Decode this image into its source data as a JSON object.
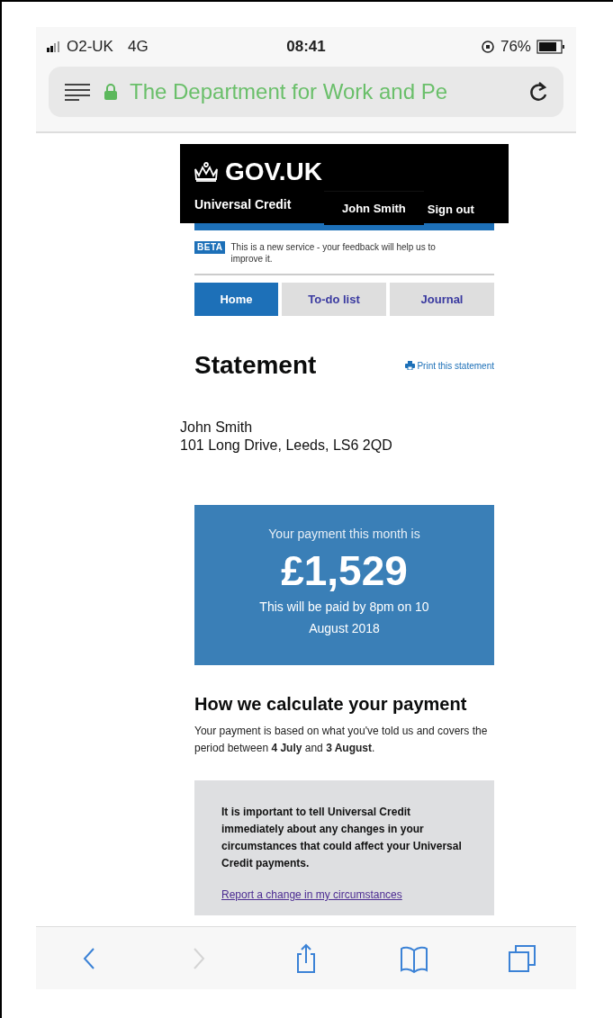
{
  "status_bar": {
    "carrier": "O2-UK",
    "network": "4G",
    "time": "08:41",
    "battery": "76%"
  },
  "address_bar": {
    "title": "The Department for Work and Pe"
  },
  "header": {
    "logo": "GOV.UK",
    "service": "Universal Credit",
    "user": "John Smith",
    "sign_out": "Sign out"
  },
  "beta": {
    "tag": "BETA",
    "message": "This is a new service - your feedback will help us to improve it."
  },
  "tabs": [
    {
      "label": "Home",
      "selected": true
    },
    {
      "label": "To-do list",
      "selected": false
    },
    {
      "label": "Journal",
      "selected": false
    }
  ],
  "title": "Statement",
  "print_link": "Print this statement",
  "address": [
    "John Smith",
    "101 Long Drive, Leeds, LS6 2QD"
  ],
  "payment": {
    "intro": "Your payment this month is",
    "amount": "£1,529",
    "note": "This will be paid by 8pm on 10 August 2018"
  },
  "calculation": {
    "heading": "How we calculate your payment",
    "text": "Your payment is based on what you've told us and covers the period between **4 July** and **3 August**."
  },
  "notice": {
    "text": "It is important to tell Universal Credit immediately about any changes in your circumstances that could affect your Universal Credit payments.",
    "link": "Report a change in my circumstances"
  },
  "toolbar": [
    {
      "kind": "back",
      "disabled": false
    },
    {
      "kind": "forward",
      "disabled": true
    },
    {
      "kind": "share",
      "disabled": false
    },
    {
      "kind": "bookmarks",
      "disabled": false
    },
    {
      "kind": "tabs",
      "disabled": false
    }
  ]
}
